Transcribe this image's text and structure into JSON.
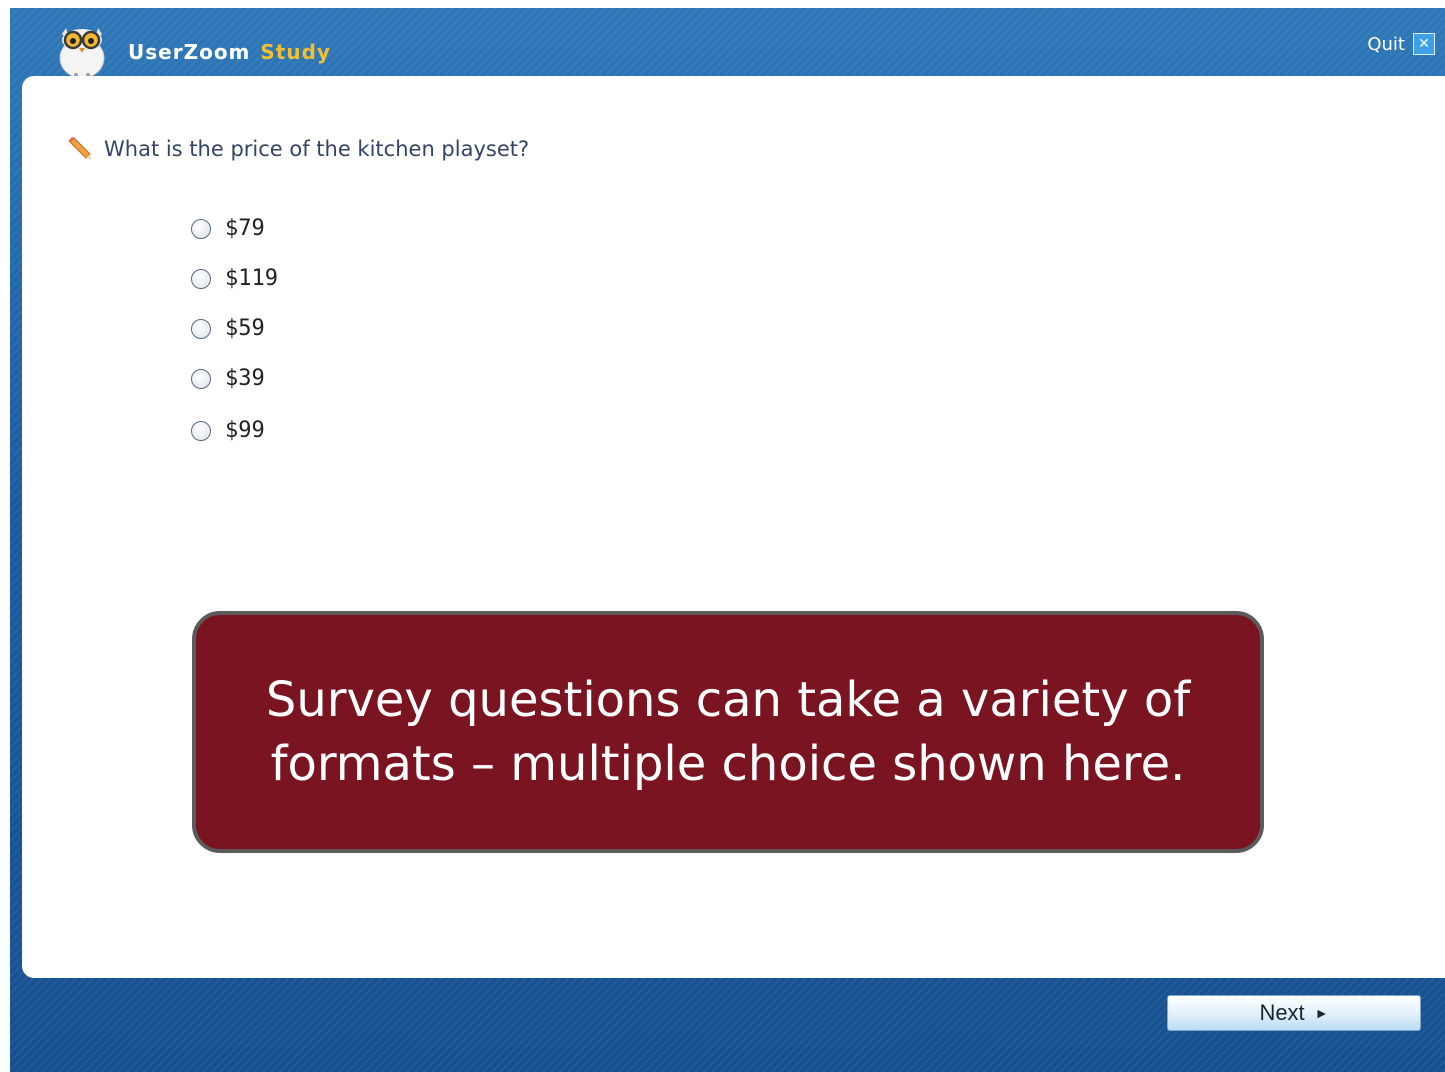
{
  "header": {
    "app_name": "UserZoom",
    "app_suffix": "Study",
    "quit_label": "Quit",
    "quit_icon": "close-box-icon",
    "logo_icon": "owl-logo-icon"
  },
  "question": {
    "icon": "pencil-icon",
    "text": "What is the price of the kitchen playset?",
    "options": [
      {
        "label": "$79"
      },
      {
        "label": "$119"
      },
      {
        "label": "$59"
      },
      {
        "label": "$39"
      },
      {
        "label": "$99"
      }
    ]
  },
  "callout": {
    "text": "Survey questions can take a variety of formats – multiple choice shown here."
  },
  "footer": {
    "next_label": "Next",
    "next_icon": "play-arrow-icon"
  },
  "colors": {
    "frame_blue": "#1c5c9f",
    "brand_yellow": "#f0c030",
    "callout_maroon": "#7a1420"
  }
}
